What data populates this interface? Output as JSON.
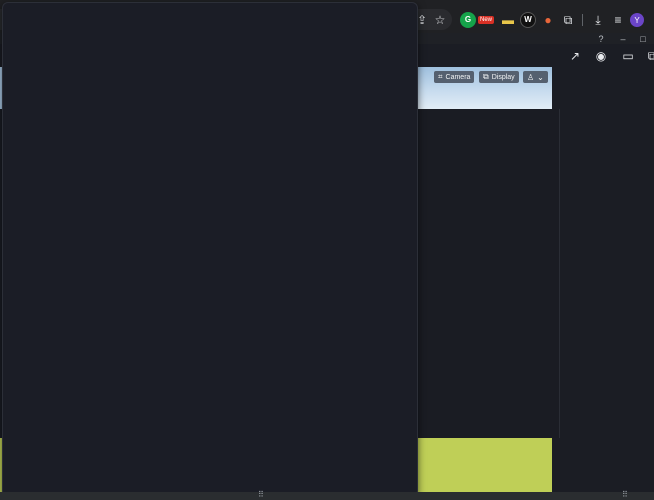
{
  "overlay_buttons": {
    "camera_label": "Camera",
    "display_label": "Display"
  },
  "browser": {
    "new_badge": "New",
    "ext_w_letter": "W",
    "avatar_initial": "Y"
  },
  "icons": {
    "share_icon": "share-icon",
    "star_icon": "star-icon",
    "grammarly_icon": "grammarly-icon",
    "extensions_icon": "puzzle-icon",
    "download_icon": "download-icon",
    "playlist_icon": "playlist-icon",
    "help_icon": "help-icon",
    "minimize_icon": "minimize-icon",
    "maximize_icon": "maximize-icon",
    "screenshot_icon": "camera-icon",
    "record_icon": "video-icon",
    "export_icon": "export-icon",
    "copy_icon": "copy-icon",
    "person_icon": "person-icon"
  },
  "colors": {
    "overlay_bg": "#1b1d26",
    "panel_bg": "#1a1c23",
    "video_green": "#bfcf57",
    "overlay_button": "#55606f",
    "avatar": "#6b45c8"
  }
}
